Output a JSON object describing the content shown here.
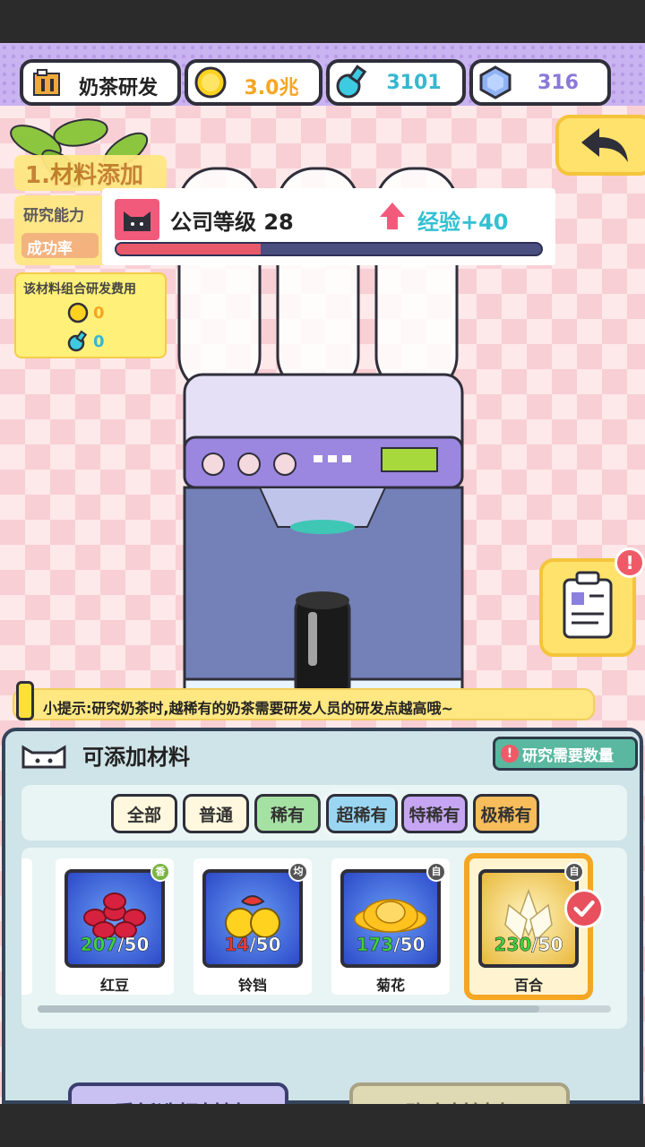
{
  "resources": {
    "title": "奶茶研发",
    "coins": "3.0兆",
    "potions": "3101",
    "gems": "316"
  },
  "left_panel": {
    "step_title": "1.材料添加",
    "ability_label": "研究能力",
    "success_label": "成功率",
    "cost_title": "该材料组合研发费用",
    "cost_coin": "0",
    "cost_potion": "0"
  },
  "level_popup": {
    "level_text": "公司等级 28",
    "exp_text": "经验+40",
    "progress": 0.34
  },
  "tip": {
    "text": "小提示:研究奶茶时,越稀有的奶茶需要研发人员的研发点越高哦~"
  },
  "panel": {
    "title": "可添加材料",
    "need_button": "研究需要数量",
    "tabs": [
      "全部",
      "普通",
      "稀有",
      "超稀有",
      "特稀有",
      "极稀有"
    ],
    "selected_tab": "超稀有",
    "items": [
      {
        "name": "红豆",
        "have": "207",
        "need": "/50",
        "tag": "香",
        "tag_color": "#7cb342",
        "have_color": "#3ed13e"
      },
      {
        "name": "铃铛",
        "have": "14",
        "need": "/50",
        "tag": "均",
        "tag_color": "#555555",
        "have_color": "#e53935"
      },
      {
        "name": "菊花",
        "have": "173",
        "need": "/50",
        "tag": "自",
        "tag_color": "#555555",
        "have_color": "#3ed13e"
      },
      {
        "name": "百合",
        "have": "230",
        "need": "/50",
        "tag": "自",
        "tag_color": "#555555",
        "have_color": "#3ed13e",
        "selected": true
      }
    ],
    "reset_button": "重新选择材料",
    "confirm_button": "确定材料表"
  },
  "colors": {
    "accent_gold": "#f5a623",
    "pink_bg": "#fde8ea",
    "panel_bg": "#cfe4e8"
  }
}
